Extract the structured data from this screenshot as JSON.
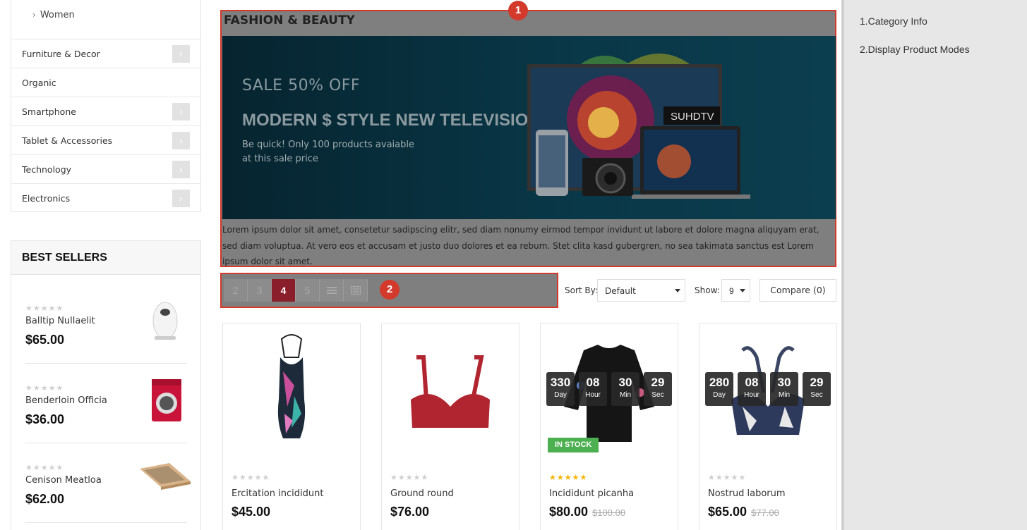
{
  "sidebar": {
    "subcategories": [
      "Women"
    ],
    "categories": [
      {
        "label": "Furniture & Decor",
        "has_children": true
      },
      {
        "label": "Organic",
        "has_children": false
      },
      {
        "label": "Smartphone",
        "has_children": true
      },
      {
        "label": "Tablet & Accessories",
        "has_children": true
      },
      {
        "label": "Technology",
        "has_children": true
      },
      {
        "label": "Electronics",
        "has_children": true
      }
    ]
  },
  "best_sellers": {
    "title": "BEST SELLERS",
    "items": [
      {
        "name": "Balltip Nullaelit",
        "price": "$65.00",
        "rating": 0,
        "icon": "speaker-image"
      },
      {
        "name": "Benderloin Officia",
        "price": "$36.00",
        "rating": 0,
        "icon": "washing-machine-image"
      },
      {
        "name": "Cenison Meatloa",
        "price": "$62.00",
        "rating": 0,
        "icon": "laptop-image"
      }
    ]
  },
  "category": {
    "title": "FASHION & BEAUTY",
    "banner": {
      "sale": "SALE 50% OFF",
      "headline": "MODERN $ STYLE NEW TELEVISION",
      "sub_line1": "Be quick! Only 100 products avaiable",
      "sub_line2": "at this sale price",
      "tv_brand": "SUHDTV"
    },
    "description": "Lorem ipsum dolor sit amet, consetetur sadipscing elitr, sed diam nonumy eirmod tempor invidunt ut labore et dolore magna aliquyam erat, sed diam voluptua. At vero eos et accusam et justo duo dolores et ea rebum. Stet clita kasd gubergren, no sea takimata sanctus est Lorem ipsum dolor sit amet."
  },
  "annotations": {
    "badge1": "1",
    "badge2": "2"
  },
  "toolbar": {
    "columns": [
      "2",
      "3",
      "4",
      "5"
    ],
    "active_column": "4",
    "sort_label": "Sort By:",
    "sort_value": "Default",
    "show_label": "Show:",
    "show_value": "9",
    "compare_label": "Compare (0)"
  },
  "products": [
    {
      "name": "Ercitation incididunt",
      "price": "$45.00",
      "old_price": "",
      "rating": 0,
      "countdown": null,
      "stock": ""
    },
    {
      "name": "Ground round",
      "price": "$76.00",
      "old_price": "",
      "rating": 0,
      "countdown": null,
      "stock": ""
    },
    {
      "name": "Incididunt picanha",
      "price": "$80.00",
      "old_price": "$100.00",
      "rating": 5,
      "countdown": {
        "day": "330",
        "hour": "08",
        "min": "30",
        "sec": "29"
      },
      "stock": "IN STOCK"
    },
    {
      "name": "Nostrud laborum",
      "price": "$65.00",
      "old_price": "$77.00",
      "rating": 0,
      "countdown": {
        "day": "280",
        "hour": "08",
        "min": "30",
        "sec": "29"
      },
      "stock": ""
    }
  ],
  "countdown_units": {
    "day": "Day",
    "hour": "Hour",
    "min": "Min",
    "sec": "Sec"
  },
  "right_panel": {
    "items": [
      "1.Category Info",
      "2.Display Product Modes"
    ]
  },
  "colors": {
    "accent_red": "#d33a2c",
    "active_page": "#8a1f2b",
    "in_stock": "#4caf50",
    "star_gold": "#f4b400"
  }
}
